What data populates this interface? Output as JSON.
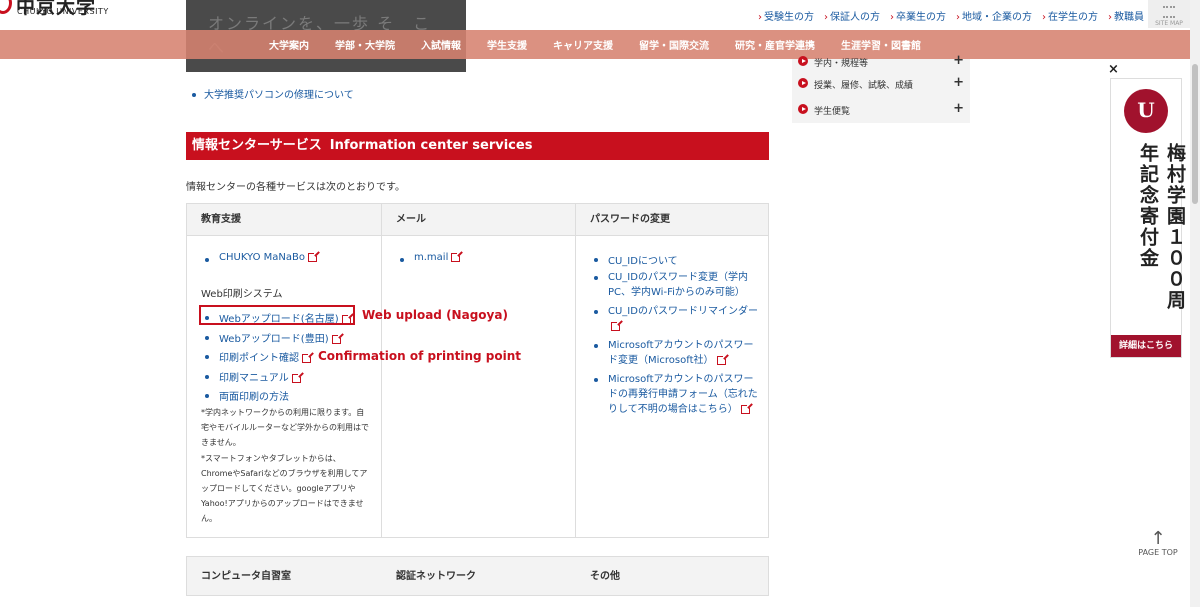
{
  "header": {
    "logo_jp": "中京大学",
    "logo_en": "CHUKYO UNIVERSITY",
    "hero_text": "オンラインを、一歩 そ　こ　へ",
    "top_links": [
      "受験生の方",
      "保証人の方",
      "卒業生の方",
      "地域・企業の方",
      "在学生の方",
      "教職員"
    ],
    "sitemap": "SITE MAP",
    "global_nav": [
      "大学案内",
      "学部・大学院",
      "入試情報",
      "学生支援",
      "キャリア支援",
      "留学・国際交流",
      "研究・産官学連携",
      "生涯学習・図書館"
    ]
  },
  "sidebar": {
    "items": [
      {
        "label": "学内・規程等"
      },
      {
        "label": "授業、履修、試験、成績"
      },
      {
        "label": "学生便覧"
      }
    ]
  },
  "main": {
    "pc_repair_link": "大学推奨パソコンの修理について",
    "section_title_jp": "情報センターサービス",
    "section_title_en": "Information center services",
    "intro": "情報センターの各種サービスは次のとおりです。",
    "columns": [
      {
        "header": "教育支援",
        "top_link": "CHUKYO MaNaBo",
        "sub_label": "Web印刷システム",
        "links": [
          "Webアップロード(名古屋)",
          "Webアップロード(豊田)",
          "印刷ポイント確認",
          "印刷マニュアル",
          "両面印刷の方法"
        ],
        "note1": "*学内ネットワークからの利用に限ります。自宅やモバイルルーターなど学外からの利用はできません。",
        "note2": "*スマートフォンやタブレットからは、ChromeやSafariなどのブラウザを利用してアップロードしてください。googleアプリやYahoo!アプリからのアップロードはできません。"
      },
      {
        "header": "メール",
        "links": [
          "m.mail"
        ]
      },
      {
        "header": "パスワードの変更",
        "links": [
          "CU_IDについて",
          "CU_IDのパスワード変更（学内PC、学内Wi-Fiからのみ可能）",
          "CU_IDのパスワードリマインダー",
          "Microsoftアカウントのパスワード変更（Microsoft社）",
          "Microsoftアカウントのパスワードの再発行申請フォーム（忘れたりして不明の場合はこちら）"
        ]
      }
    ],
    "second_row_headers": [
      "コンピュータ自習室",
      "認証ネットワーク",
      "その他"
    ]
  },
  "annotations": {
    "web_upload": "Web upload (Nagoya)",
    "printing_point": "Confirmation of printing point"
  },
  "banner": {
    "emblem": "U",
    "text": "梅村学園１００周年記念寄付金",
    "button": "詳細はこちら",
    "close": "×"
  },
  "page_top": "PAGE TOP",
  "colors": {
    "accent": "#c8101e",
    "nav_bg": "#d68270",
    "link": "#1a5aa0",
    "banner": "#a1122d"
  }
}
